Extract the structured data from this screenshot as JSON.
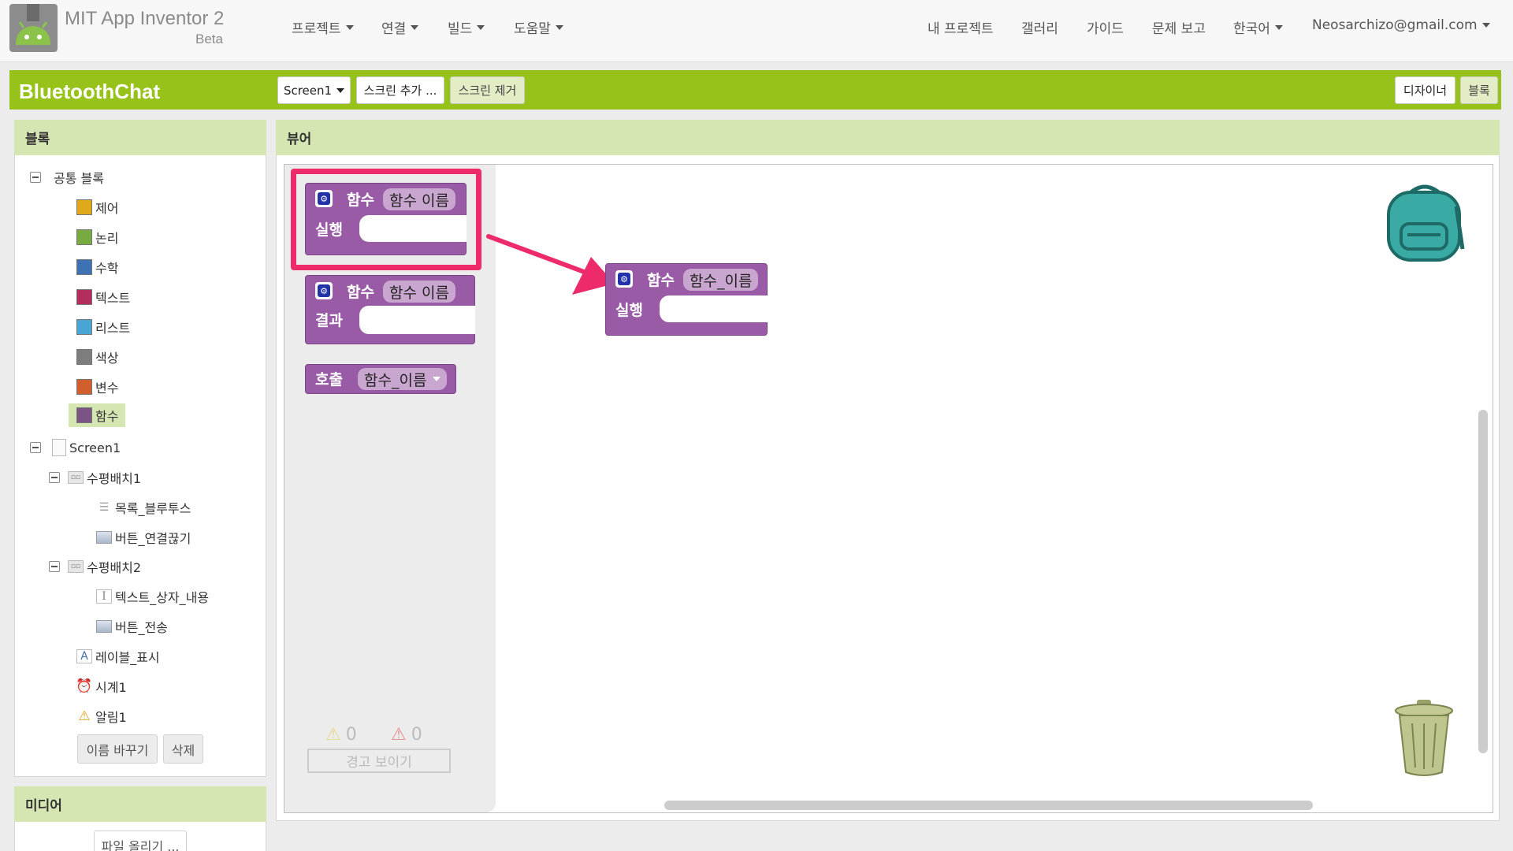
{
  "app": {
    "title": "MIT App Inventor 2",
    "subtitle": "Beta"
  },
  "nav": {
    "menus": [
      "프로젝트",
      "연결",
      "빌드",
      "도움말"
    ],
    "right": [
      "내 프로젝트",
      "갤러리",
      "가이드",
      "문제 보고"
    ],
    "language": "한국어",
    "account": "Neosarchizo@gmail.com"
  },
  "project": {
    "name": "BluetoothChat",
    "screen_selector": "Screen1",
    "add_screen": "스크린 추가 ...",
    "remove_screen": "스크린 제거",
    "designer": "디자이너",
    "blocks": "블록"
  },
  "blocks_panel": {
    "title": "블록",
    "builtin_label": "공통 블록",
    "builtin": [
      {
        "label": "제어",
        "color": "#e1a91a"
      },
      {
        "label": "논리",
        "color": "#77ab41"
      },
      {
        "label": "수학",
        "color": "#3f71b5"
      },
      {
        "label": "텍스트",
        "color": "#b32d5e"
      },
      {
        "label": "리스트",
        "color": "#49a6d4"
      },
      {
        "label": "색상",
        "color": "#7d7d7d"
      },
      {
        "label": "변수",
        "color": "#d05f2d"
      },
      {
        "label": "함수",
        "color": "#7c5385"
      }
    ],
    "components": {
      "screen": "Screen1",
      "hz1": "수평배치1",
      "list_bt": "목록_블루투스",
      "btn_disconnect": "버튼_연결끊기",
      "hz2": "수평배치2",
      "text_content": "텍스트_상자_내용",
      "btn_send": "버튼_전송",
      "label_show": "레이블_표시",
      "clock": "시계1",
      "notifier": "알림1"
    },
    "rename_button": "이름 바꾸기",
    "delete_button": "삭제"
  },
  "media_panel": {
    "title": "미디어",
    "upload_button": "파일 올리기 ..."
  },
  "viewer": {
    "title": "뷰어",
    "flyout": {
      "proc_do": {
        "keyword": "함수",
        "name": "함수 이름",
        "body": "실행"
      },
      "proc_result": {
        "keyword": "함수",
        "name": "함수 이름",
        "body": "결과"
      },
      "call": {
        "keyword": "호출",
        "name": "함수_이름"
      }
    },
    "placed_block": {
      "keyword": "함수",
      "name": "함수_이름",
      "body": "실행"
    },
    "warnings": {
      "warning_count": "0",
      "error_count": "0",
      "show_button": "경고 보이기"
    },
    "highlight_color": "#ed2b6a",
    "block_color": "#995ba5"
  }
}
